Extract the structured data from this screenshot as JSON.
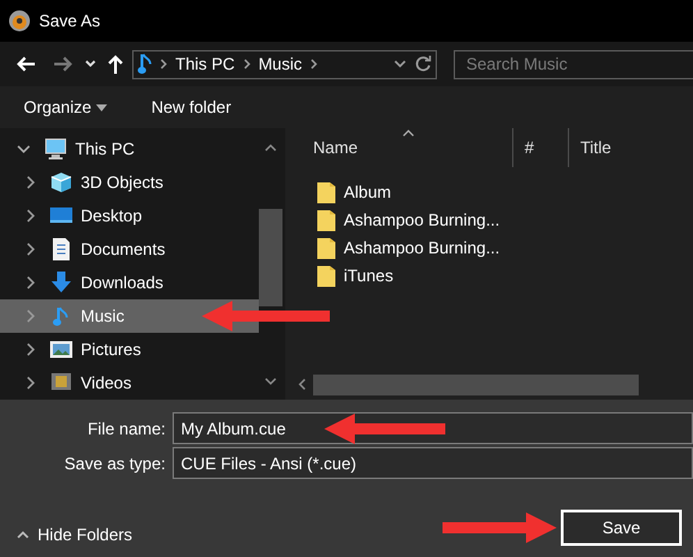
{
  "window": {
    "title": "Save As"
  },
  "navigation": {
    "back_disabled": false,
    "forward_disabled": true,
    "breadcrumb": [
      "This PC",
      "Music"
    ],
    "search": {
      "placeholder": "Search Music"
    }
  },
  "toolbar": {
    "buttons": [
      {
        "label": "Organize",
        "dropdown": true
      },
      {
        "label": "New folder",
        "dropdown": false
      }
    ]
  },
  "sidebar": {
    "items": [
      {
        "label": "This PC",
        "kind": "pc",
        "expanded": true,
        "selected": false,
        "marked": false,
        "children": [
          {
            "label": "3D Objects",
            "kind": "objects",
            "expanded": false,
            "selected": false,
            "marked": false
          },
          {
            "label": "Desktop",
            "kind": "desktop",
            "expanded": false,
            "selected": false,
            "marked": false
          },
          {
            "label": "Documents",
            "kind": "documents",
            "expanded": false,
            "selected": false,
            "marked": false
          },
          {
            "label": "Downloads",
            "kind": "downloads",
            "expanded": false,
            "selected": false,
            "marked": false
          },
          {
            "label": "Music",
            "kind": "music",
            "expanded": false,
            "selected": true,
            "marked": true
          },
          {
            "label": "Pictures",
            "kind": "pictures",
            "expanded": false,
            "selected": false,
            "marked": false
          },
          {
            "label": "Videos",
            "kind": "videos",
            "expanded": false,
            "selected": false,
            "marked": false
          }
        ]
      }
    ]
  },
  "file_list": {
    "columns": [
      {
        "label": "Name",
        "sorted": true
      },
      {
        "label": "#",
        "sorted": false
      },
      {
        "label": "Title",
        "sorted": false
      }
    ],
    "rows": [
      {
        "name": "Album"
      },
      {
        "name": "Ashampoo Burning..."
      },
      {
        "name": "Ashampoo Burning..."
      },
      {
        "name": "iTunes"
      }
    ]
  },
  "form": {
    "fields": [
      {
        "label": "File name:",
        "value": "My Album.cue",
        "marked": true
      },
      {
        "label": "Save as type:",
        "value": "CUE Files - Ansi (*.cue)",
        "marked": false
      }
    ]
  },
  "footer": {
    "hide_folders": "Hide Folders",
    "save_button": {
      "label": "Save",
      "marked": true
    }
  }
}
